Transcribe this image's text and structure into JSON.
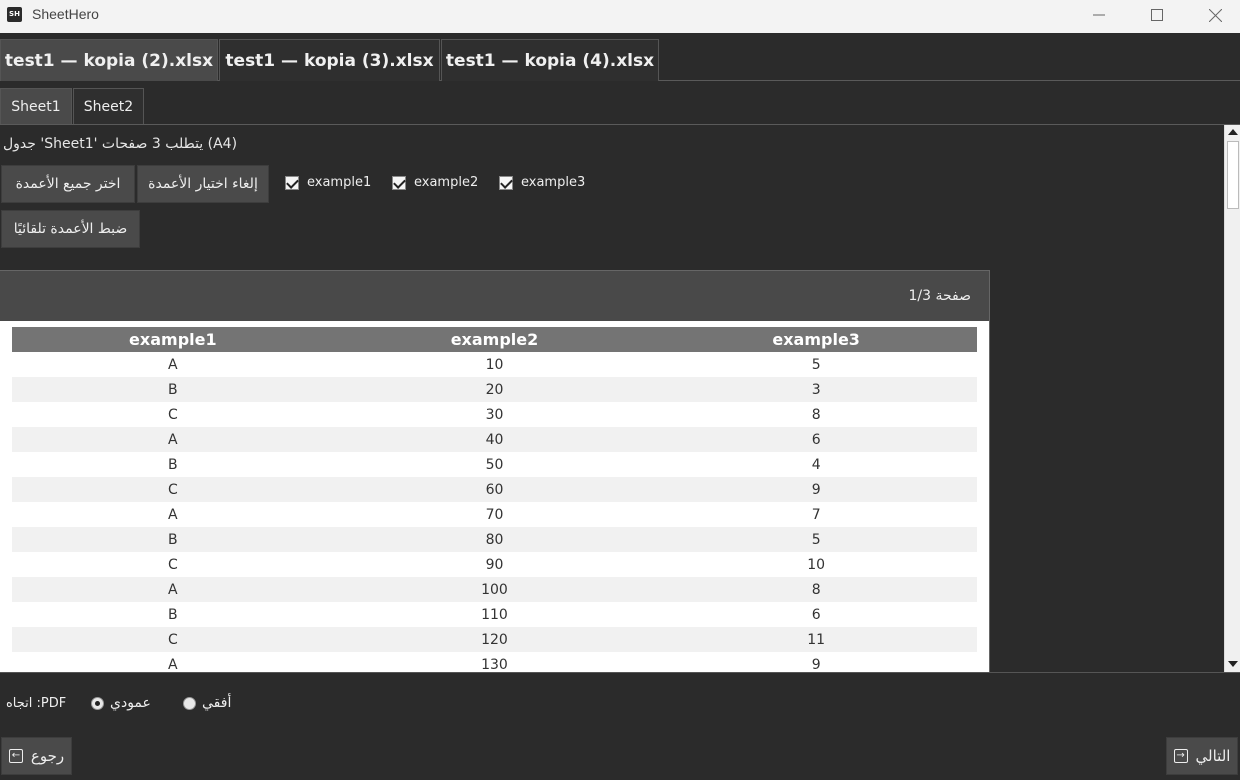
{
  "window": {
    "title": "SheetHero",
    "icon_text": "SH",
    "controls": [
      "minimize-icon",
      "maximize-icon",
      "close-icon"
    ]
  },
  "file_tabs": [
    {
      "label": "test1 — kopia (2).xlsx",
      "active": true
    },
    {
      "label": "test1 — kopia (3).xlsx",
      "active": false
    },
    {
      "label": "test1 — kopia (4).xlsx",
      "active": false
    }
  ],
  "sheet_tabs": [
    {
      "label": "Sheet1",
      "active": true
    },
    {
      "label": "Sheet2",
      "active": false
    }
  ],
  "toolbar": {
    "pages_info": "(A4) يتطلب 3 صفحات 'Sheet1' جدول",
    "select_all": "اختر جميع الأعمدة",
    "deselect_all": "إلغاء اختيار الأعمدة",
    "auto_fit": "ضبط الأعمدة تلقائيًا",
    "columns": [
      {
        "label": "example1",
        "checked": true
      },
      {
        "label": "example2",
        "checked": true
      },
      {
        "label": "example3",
        "checked": true
      }
    ]
  },
  "preview": {
    "page_label": "صفحة 1/3",
    "headers": [
      "example1",
      "example2",
      "example3"
    ],
    "rows": [
      [
        "A",
        "10",
        "5"
      ],
      [
        "B",
        "20",
        "3"
      ],
      [
        "C",
        "30",
        "8"
      ],
      [
        "A",
        "40",
        "6"
      ],
      [
        "B",
        "50",
        "4"
      ],
      [
        "C",
        "60",
        "9"
      ],
      [
        "A",
        "70",
        "7"
      ],
      [
        "B",
        "80",
        "5"
      ],
      [
        "C",
        "90",
        "10"
      ],
      [
        "A",
        "100",
        "8"
      ],
      [
        "B",
        "110",
        "6"
      ],
      [
        "C",
        "120",
        "11"
      ],
      [
        "A",
        "130",
        "9"
      ]
    ]
  },
  "footer": {
    "orientation_label": "PDF: اتجاه",
    "portrait": "عمودي",
    "landscape": "أفقي",
    "selected": "portrait",
    "back": "رجوع",
    "next": "التالي"
  },
  "colors": {
    "background": "#2b2b2b",
    "button": "#4a4a4a",
    "table_header": "#747474",
    "row_alt": "#f1f1f1"
  }
}
